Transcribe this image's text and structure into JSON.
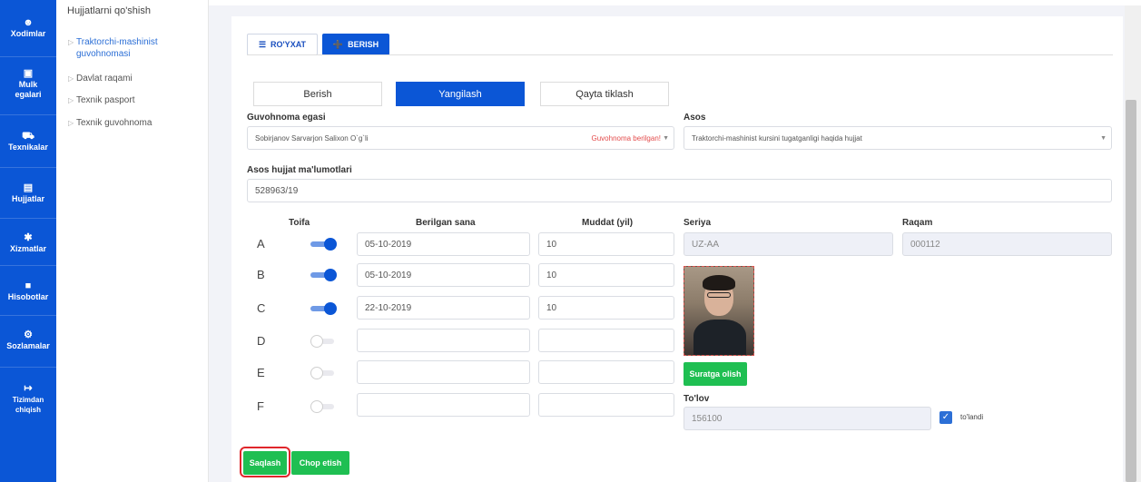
{
  "sidebar": {
    "items": [
      {
        "label": "Xodimlar",
        "icon": "user-icon"
      },
      {
        "label": "Mulk egalari",
        "icon": "cube-icon"
      },
      {
        "label": "Texnikalar",
        "icon": "truck-icon"
      },
      {
        "label": "Hujjatlar",
        "icon": "document-icon"
      },
      {
        "label": "Xizmatlar",
        "icon": "wrench-icon"
      },
      {
        "label": "Hisobotlar",
        "icon": "report-icon"
      },
      {
        "label": "Sozlamalar",
        "icon": "gear-icon"
      },
      {
        "label": "Tizimdan chiqish",
        "icon": "logout-icon"
      }
    ]
  },
  "subnav": {
    "title": "Hujjatlarni qo'shish",
    "items": [
      {
        "label_line1": "Traktorchi-mashinist",
        "label_line2": "guvohnomasi"
      },
      {
        "label": "Davlat raqami"
      },
      {
        "label": "Texnik pasport"
      },
      {
        "label": "Texnik guvohnoma"
      }
    ]
  },
  "tabs": {
    "list_label": "RO'YXAT",
    "give_label": "BERISH"
  },
  "segments": {
    "berish": "Berish",
    "yangilash": "Yangilash",
    "qayta": "Qayta tiklash"
  },
  "form": {
    "owner_label": "Guvohnoma egasi",
    "owner_value": "Sobirjanov Sarvarjon Salixon O`g`li",
    "owner_status": "Guvohnoma berilgan!",
    "basis_label": "Asos",
    "basis_value": "Traktorchi-mashinist kursini tugatganligi haqida hujjat",
    "basis_doc_label": "Asos hujjat ma'lumotlari",
    "basis_doc_value": "528963/19",
    "col_category": "Toifa",
    "col_date": "Berilgan sana",
    "col_term": "Muddat (yil)",
    "col_series": "Seriya",
    "col_number": "Raqam",
    "series_value": "UZ-AA",
    "number_value": "000112",
    "categories": [
      {
        "letter": "A",
        "enabled": true,
        "date": "05-10-2019",
        "term": "10"
      },
      {
        "letter": "B",
        "enabled": true,
        "date": "05-10-2019",
        "term": "10"
      },
      {
        "letter": "C",
        "enabled": true,
        "date": "22-10-2019",
        "term": "10"
      },
      {
        "letter": "D",
        "enabled": false,
        "date": "",
        "term": ""
      },
      {
        "letter": "E",
        "enabled": false,
        "date": "",
        "term": ""
      },
      {
        "letter": "F",
        "enabled": false,
        "date": "",
        "term": ""
      }
    ],
    "photo_button": "Suratga olish",
    "payment_label": "To'lov",
    "payment_value": "156100",
    "paid_label": "to'landi"
  },
  "actions": {
    "save": "Saqlash",
    "print": "Chop etish"
  },
  "colors": {
    "primary": "#0b56d6",
    "success": "#1fbf52",
    "danger": "#e34b4b"
  }
}
